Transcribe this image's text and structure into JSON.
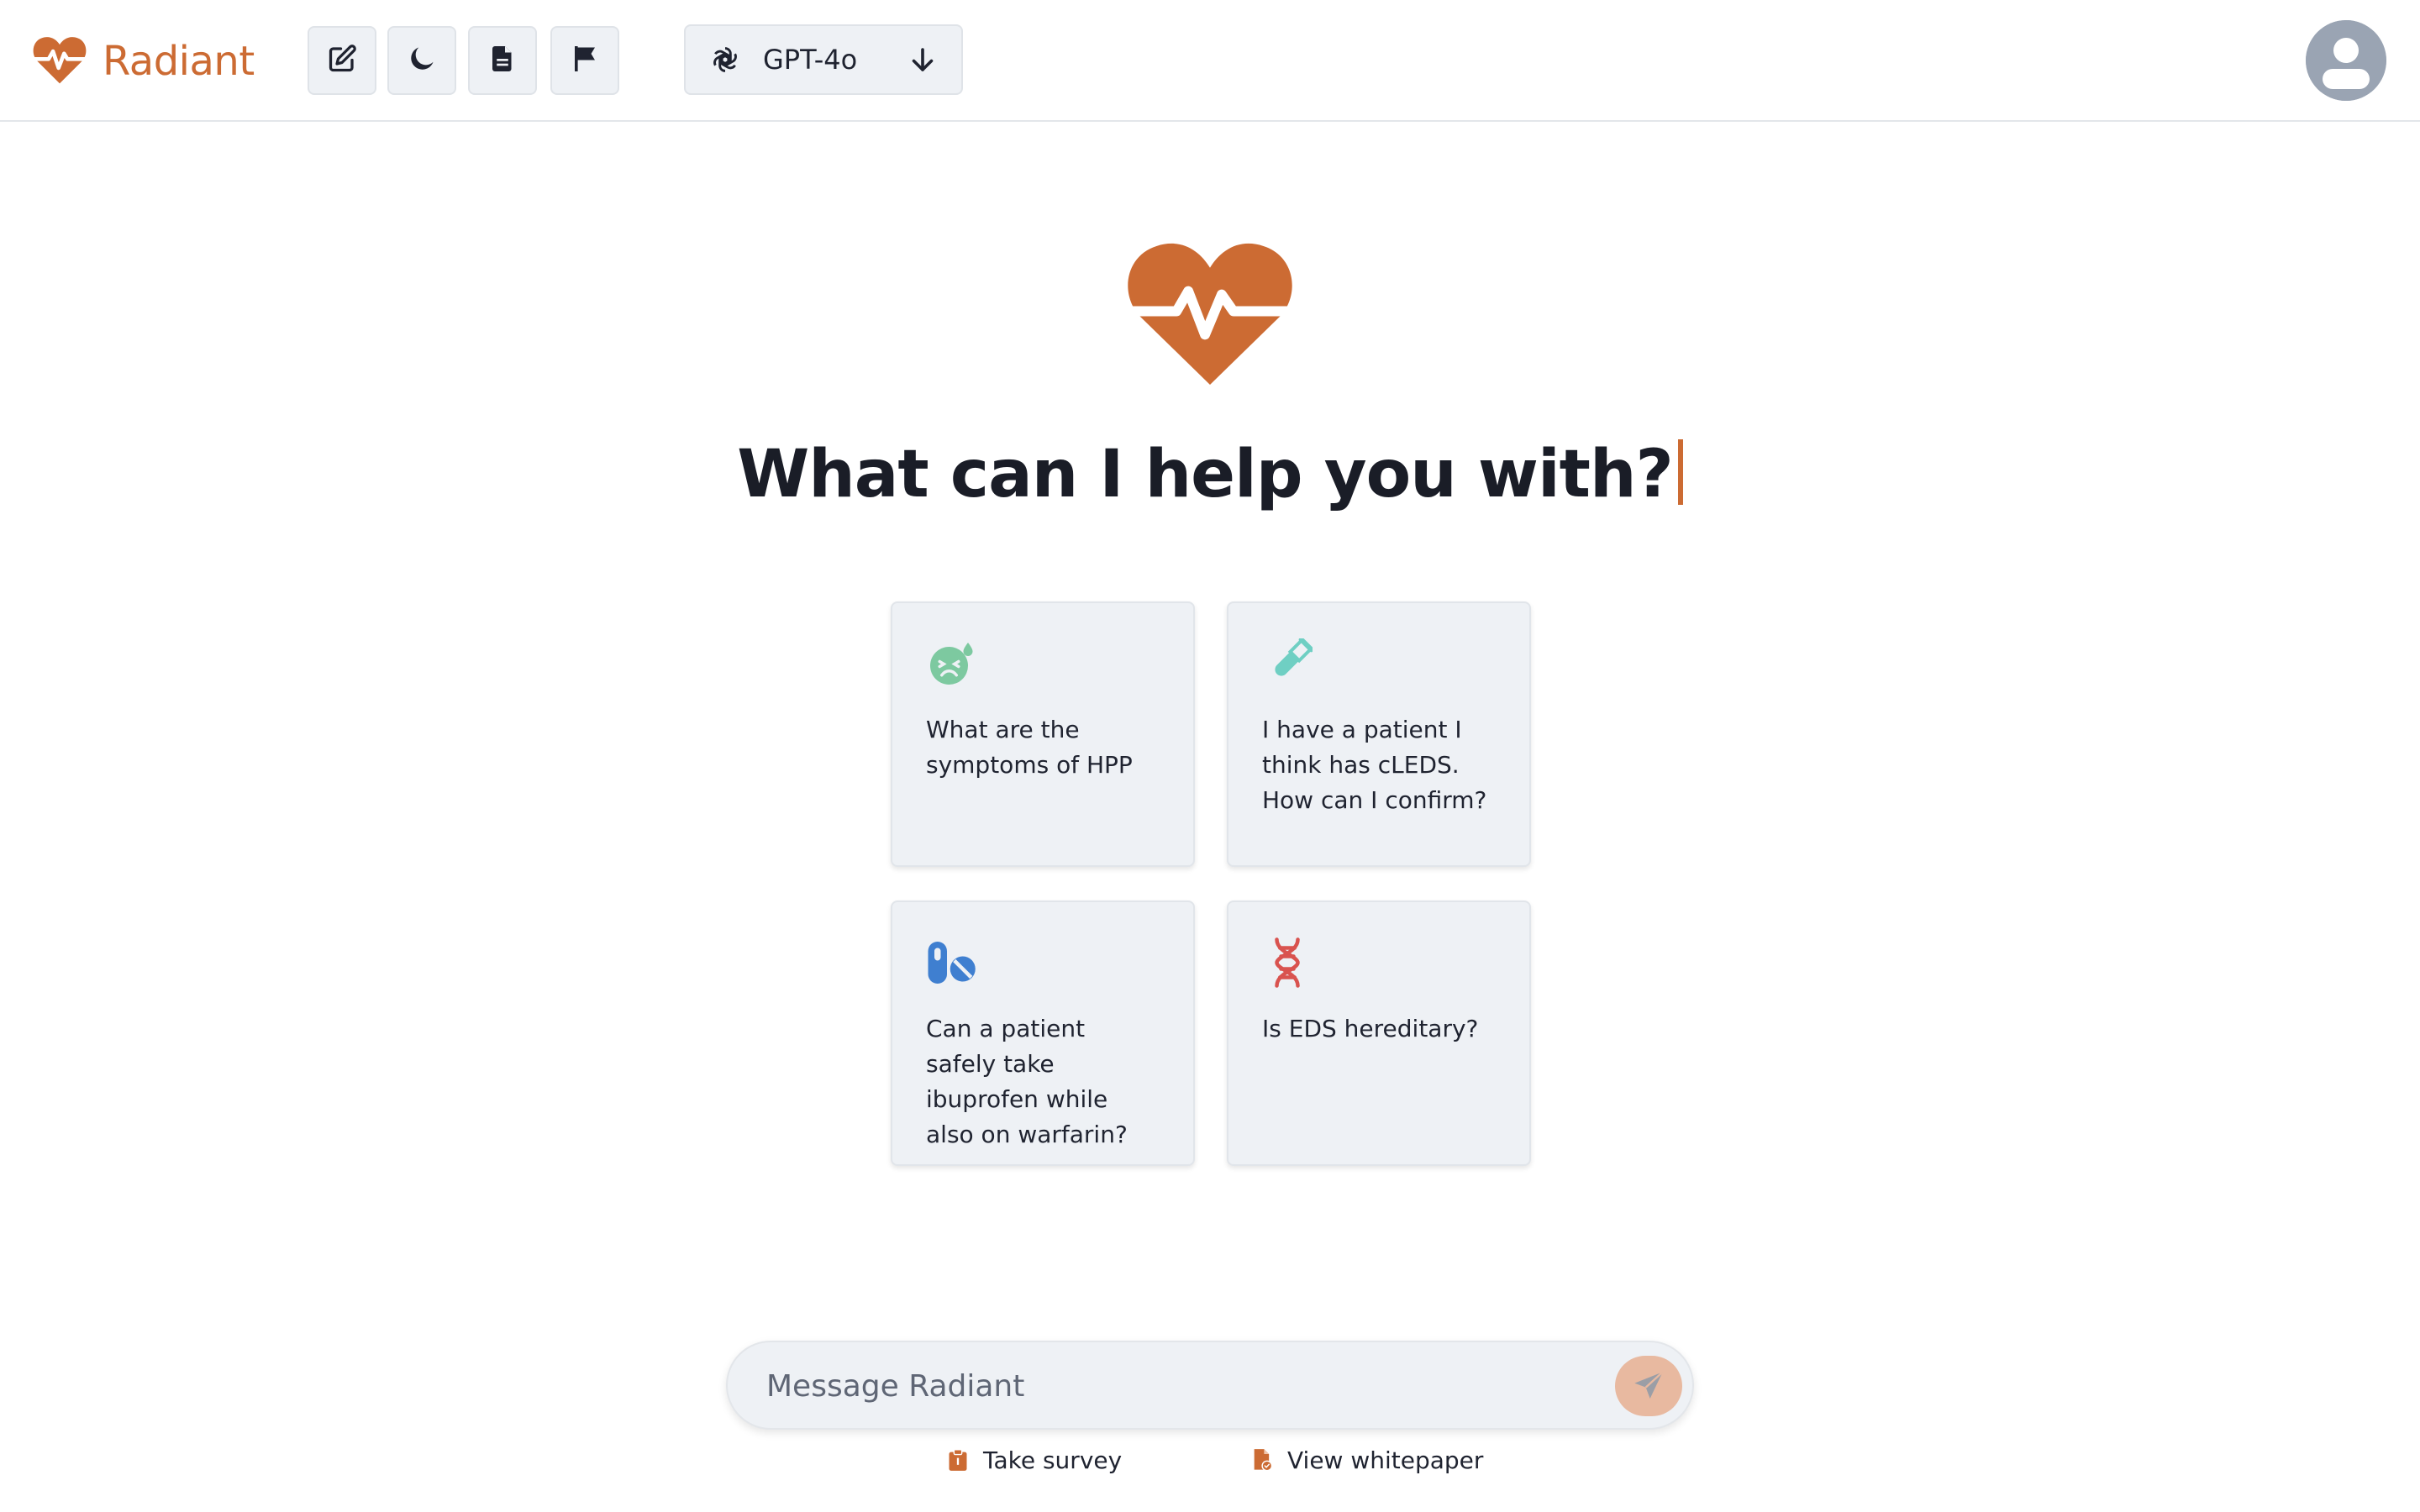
{
  "brand": {
    "name": "Radiant",
    "accent_color": "#cc6b33"
  },
  "toolbar": {
    "buttons": [
      {
        "icon": "edit-icon"
      },
      {
        "icon": "moon-icon"
      },
      {
        "icon": "document-icon"
      },
      {
        "icon": "flag-icon"
      }
    ]
  },
  "model_selector": {
    "icon": "openai-icon",
    "selected": "GPT-4o",
    "arrow_icon": "arrow-down-icon"
  },
  "user": {
    "avatar_icon": "user-avatar-icon"
  },
  "hero": {
    "logo_icon": "heartbeat-heart-icon",
    "title": "What can I help you with?"
  },
  "suggestions": [
    {
      "icon": "sick-face-icon",
      "icon_color": "#7dc9a0",
      "text": "What are the symptoms of HPP"
    },
    {
      "icon": "test-tube-icon",
      "icon_color": "#6fcfc3",
      "text": "I have a patient I think has cLEDS. How can I confirm?"
    },
    {
      "icon": "pills-icon",
      "icon_color": "#3f7fd0",
      "text": "Can a patient safely take ibuprofen while also on warfarin?"
    },
    {
      "icon": "dna-icon",
      "icon_color": "#d9534f",
      "text": "Is EDS hereditary?"
    }
  ],
  "composer": {
    "placeholder": "Message Radiant",
    "send_icon": "send-icon"
  },
  "footer": {
    "survey_label": "Take survey",
    "survey_icon": "clipboard-icon",
    "whitepaper_label": "View whitepaper",
    "whitepaper_icon": "file-check-icon"
  }
}
